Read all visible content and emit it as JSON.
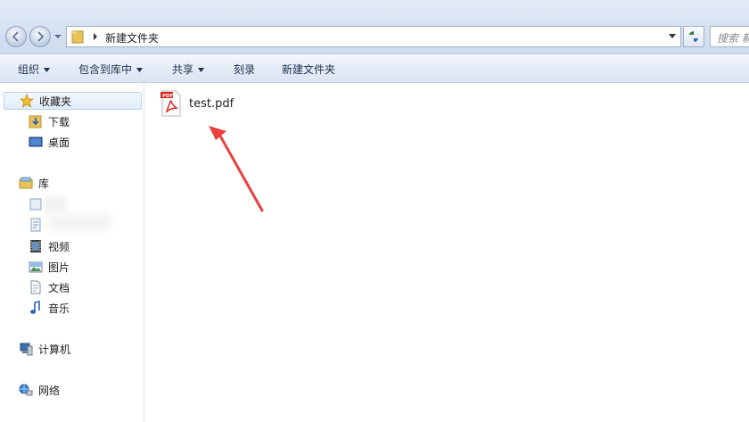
{
  "address": {
    "path": "新建文件夹",
    "search_placeholder": "搜索 新"
  },
  "toolbar": {
    "organize": "组织",
    "include_in_library": "包含到库中",
    "share": "共享",
    "burn": "刻录",
    "new_folder": "新建文件夹"
  },
  "sidebar": {
    "favorites": "收藏夹",
    "downloads": "下载",
    "desktop": "桌面",
    "libraries": "库",
    "videos": "视频",
    "pictures": "图片",
    "documents": "文档",
    "music": "音乐",
    "computer": "计算机",
    "network": "网络"
  },
  "files": [
    {
      "name": "test.pdf",
      "icon": "pdf-file-icon",
      "badge": "PDF"
    }
  ],
  "annotation": {
    "arrow_color": "#e8413c"
  }
}
